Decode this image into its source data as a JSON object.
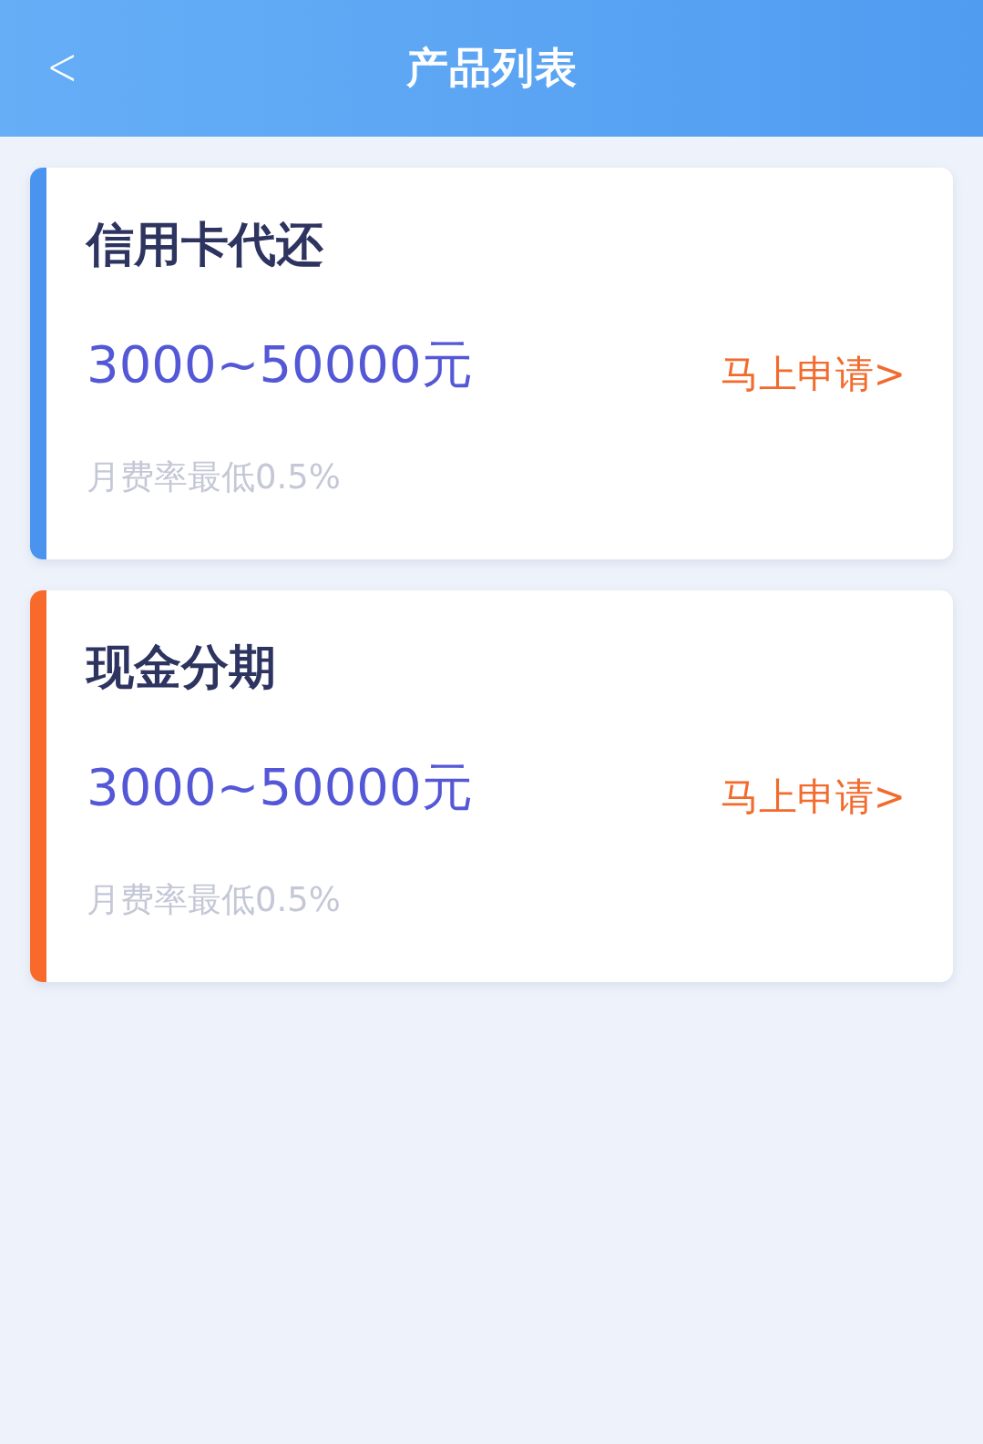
{
  "header": {
    "back": "<",
    "title": "产品列表"
  },
  "products": [
    {
      "name": "信用卡代还",
      "amount": "3000~50000元",
      "action": "马上申请>",
      "rate": "月费率最低0.5%",
      "color": "#4a93ee"
    },
    {
      "name": "现金分期",
      "amount": "3000~50000元",
      "action": "马上申请>",
      "rate": "月费率最低0.5%",
      "color": "#f76a2c"
    }
  ]
}
